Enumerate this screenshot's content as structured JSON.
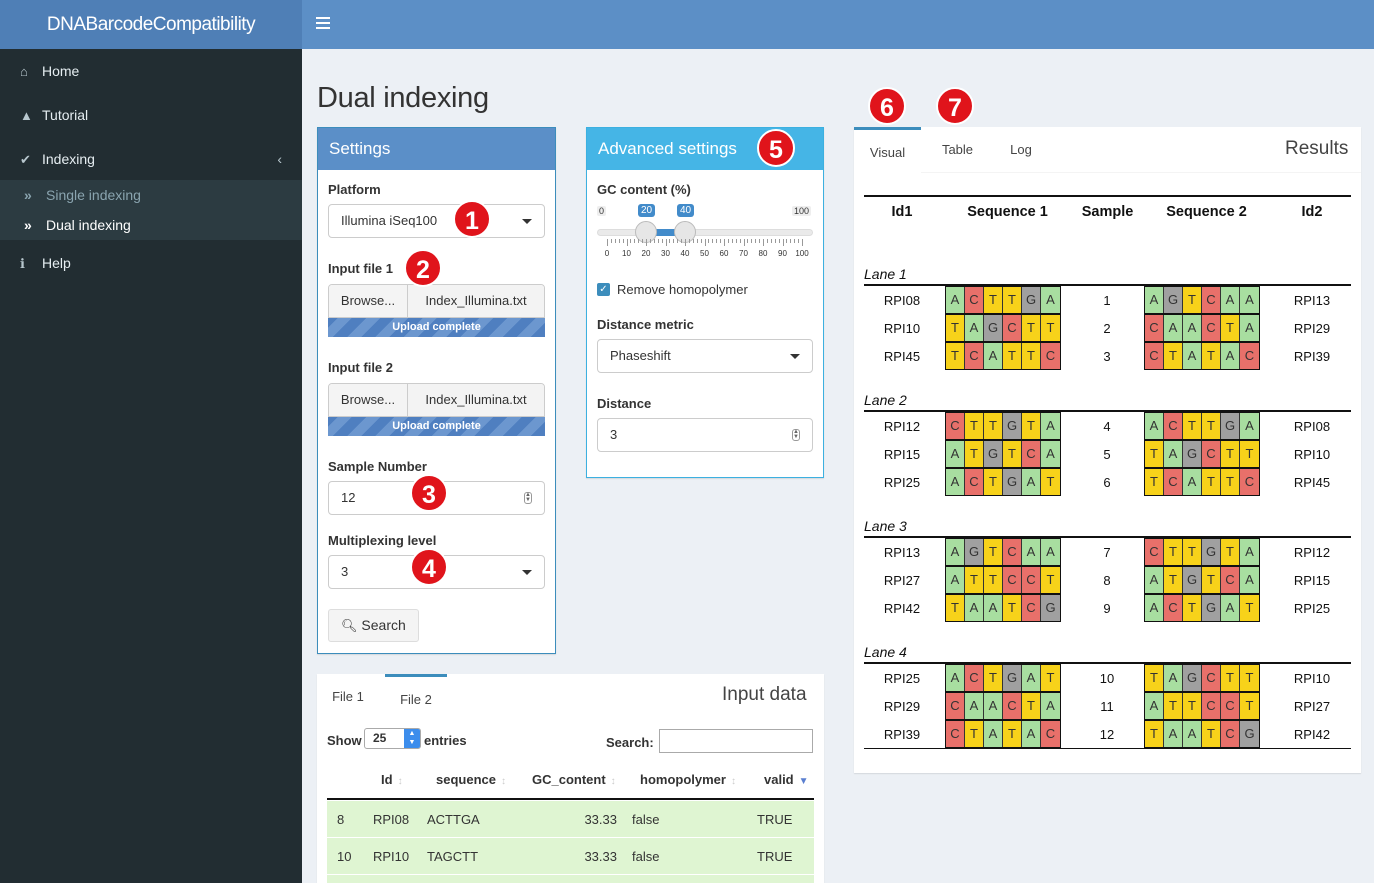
{
  "app": {
    "title": "DNABarcodeCompatibility"
  },
  "sidebar": {
    "items": [
      {
        "label": "Home",
        "icon": "home-icon"
      },
      {
        "label": "Tutorial",
        "icon": "graduation-cap-icon"
      },
      {
        "label": "Indexing",
        "icon": "wrench-icon"
      },
      {
        "label": "Help",
        "icon": "info-icon"
      }
    ],
    "sub": [
      {
        "label": "Single indexing"
      },
      {
        "label": "Dual indexing"
      }
    ]
  },
  "page": {
    "title": "Dual indexing"
  },
  "settings": {
    "header": "Settings",
    "platform_label": "Platform",
    "platform_value": "Illumina iSeq100",
    "file1_label": "Input file 1",
    "file2_label": "Input file 2",
    "browse": "Browse...",
    "file1_name": "Index_Illumina.txt",
    "file2_name": "Index_Illumina.txt",
    "upload": "Upload complete",
    "sample_label": "Sample Number",
    "sample_value": "12",
    "mux_label": "Multiplexing level",
    "mux_value": "3",
    "search": "Search"
  },
  "advanced": {
    "header": "Advanced settings",
    "gc_label": "GC content (%)",
    "gc_min": "0",
    "gc_max": "100",
    "gc_low": "20",
    "gc_high": "40",
    "ticks": [
      "0",
      "10",
      "20",
      "30",
      "40",
      "50",
      "60",
      "70",
      "80",
      "90",
      "100"
    ],
    "homopolymer": "Remove homopolymer",
    "dist_metric_label": "Distance metric",
    "dist_metric_value": "Phaseshift",
    "distance_label": "Distance",
    "distance_value": "3"
  },
  "badges": [
    "1",
    "2",
    "3",
    "4",
    "5",
    "6",
    "7"
  ],
  "results": {
    "title": "Results",
    "tabs": [
      "Visual",
      "Table",
      "Log"
    ],
    "headers": [
      "Id1",
      "Sequence 1",
      "Sample",
      "Sequence 2",
      "Id2"
    ],
    "lanes": [
      {
        "label": "Lane 1",
        "rows": [
          [
            "RPI08",
            "ACTTGA",
            "1",
            "AGTCAA",
            "RPI13"
          ],
          [
            "RPI10",
            "TAGCTT",
            "2",
            "CAACTA",
            "RPI29"
          ],
          [
            "RPI45",
            "TCATTC",
            "3",
            "CTATAC",
            "RPI39"
          ]
        ]
      },
      {
        "label": "Lane 2",
        "rows": [
          [
            "RPI12",
            "CTTGTA",
            "4",
            "ACTTGA",
            "RPI08"
          ],
          [
            "RPI15",
            "ATGTCA",
            "5",
            "TAGCTT",
            "RPI10"
          ],
          [
            "RPI25",
            "ACTGAT",
            "6",
            "TCATTC",
            "RPI45"
          ]
        ]
      },
      {
        "label": "Lane 3",
        "rows": [
          [
            "RPI13",
            "AGTCAA",
            "7",
            "CTTGTA",
            "RPI12"
          ],
          [
            "RPI27",
            "ATTCCT",
            "8",
            "ATGTCA",
            "RPI15"
          ],
          [
            "RPI42",
            "TAATCG",
            "9",
            "ACTGAT",
            "RPI25"
          ]
        ]
      },
      {
        "label": "Lane 4",
        "rows": [
          [
            "RPI25",
            "ACTGAT",
            "10",
            "TAGCTT",
            "RPI10"
          ],
          [
            "RPI29",
            "CAACTA",
            "11",
            "ATTCCT",
            "RPI27"
          ],
          [
            "RPI39",
            "CTATAC",
            "12",
            "TAATCG",
            "RPI42"
          ]
        ]
      }
    ]
  },
  "base_colors": {
    "A": "#a8dea0",
    "C": "#e8706a",
    "G": "#a0a0a0",
    "T": "#f7d21a"
  },
  "input": {
    "title": "Input data",
    "tabs": [
      "File 1",
      "File 2"
    ],
    "show": "Show",
    "entries_value": "25",
    "entries": "entries",
    "search_label": "Search:",
    "columns": [
      "Id",
      "sequence",
      "GC_content",
      "homopolymer",
      "valid"
    ],
    "rows": [
      [
        "8",
        "RPI08",
        "ACTTGA",
        "33.33",
        "false",
        "TRUE"
      ],
      [
        "10",
        "RPI10",
        "TAGCTT",
        "33.33",
        "false",
        "TRUE"
      ]
    ]
  }
}
